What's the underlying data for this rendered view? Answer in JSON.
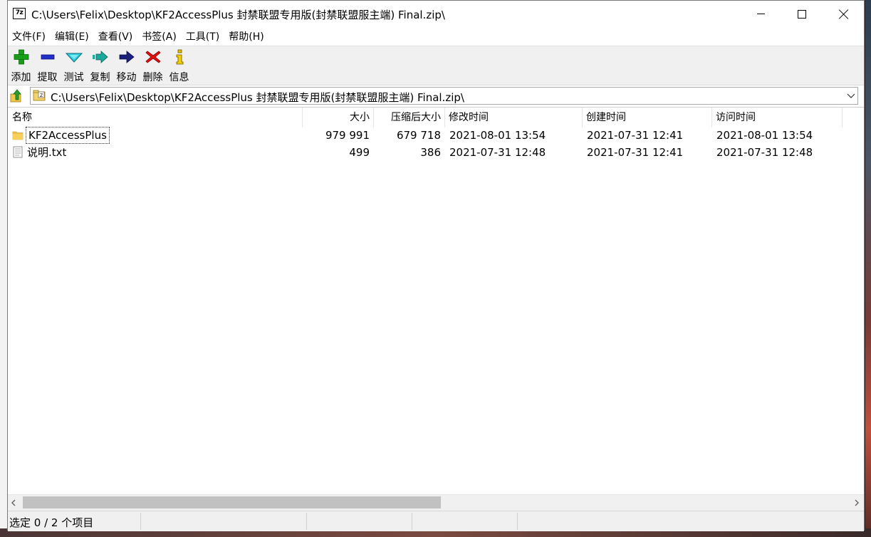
{
  "window": {
    "app_icon_text": "7z",
    "title": "C:\\Users\\Felix\\Desktop\\KF2AccessPlus 封禁联盟专用版(封禁联盟服主端) Final.zip\\"
  },
  "menu": [
    "文件(F)",
    "编辑(E)",
    "查看(V)",
    "书签(A)",
    "工具(T)",
    "帮助(H)"
  ],
  "toolbar": {
    "add": "添加",
    "extract": "提取",
    "test": "测试",
    "copy": "复制",
    "move": "移动",
    "delete": "删除",
    "info": "信息"
  },
  "address": {
    "path": "C:\\Users\\Felix\\Desktop\\KF2AccessPlus 封禁联盟专用版(封禁联盟服主端) Final.zip\\"
  },
  "columns": {
    "name": "名称",
    "size": "大小",
    "packed": "压缩后大小",
    "modified": "修改时间",
    "created": "创建时间",
    "accessed": "访问时间"
  },
  "files": [
    {
      "icon": "folder-icon",
      "name": "KF2AccessPlus",
      "size": "979 991",
      "packed": "679 718",
      "modified": "2021-08-01 13:54",
      "created": "2021-07-31 12:41",
      "accessed": "2021-08-01 13:54"
    },
    {
      "icon": "text-file-icon",
      "name": "说明.txt",
      "size": "499",
      "packed": "386",
      "modified": "2021-07-31 12:48",
      "created": "2021-07-31 12:41",
      "accessed": "2021-07-31 12:48"
    }
  ],
  "status": {
    "selection": "选定 0 / 2 个项目"
  },
  "colors": {
    "toolbar_bg": "#f0f0f0",
    "add_green": "#1a9e1a",
    "delete_red": "#e01010",
    "scroll_thumb": "#c1c1c1"
  }
}
